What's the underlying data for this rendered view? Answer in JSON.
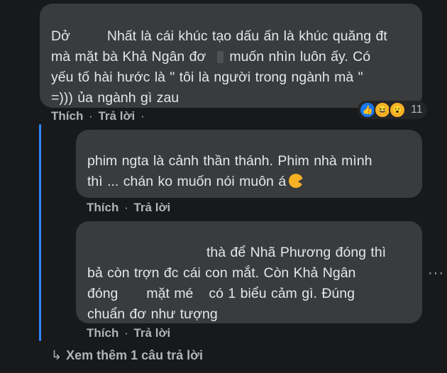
{
  "comments": [
    {
      "lines": [
        [
          "Dở",
          "Nhất là cái khúc tạo dấu ấn là khúc quăng đt"
        ],
        [
          "mà mặt bà Khả Ngân đơ",
          "muốn nhìn luôn ấy. Có"
        ],
        [
          "yếu tố hài hước là \" tôi là người trong ngành mà \""
        ],
        [
          "=))) ủa ngành gì zau"
        ]
      ],
      "like_label": "Thích",
      "reply_label": "Trả lời",
      "dot": "·",
      "reactions": {
        "icons": [
          "like-icon",
          "haha-icon",
          "wow-icon"
        ],
        "count": "11"
      }
    },
    {
      "lines": [
        [
          "phim ngta là cảnh thần thánh. Phim nhà mình"
        ],
        [
          "thì ... chán ko muốn nói muôn á"
        ]
      ],
      "like_label": "Thích",
      "reply_label": "Trả lời",
      "dot": "·"
    },
    {
      "lines": [
        [
          "thà để Nhã Phương đóng thì"
        ],
        [
          "bả còn trợn đc cái con mắt. Còn Khả Ngân"
        ],
        [
          "đóng",
          "mặt mé",
          "có 1 biểu cảm gì. Đúng"
        ],
        [
          "chuẩn đơ như tượng"
        ]
      ],
      "like_label": "Thích",
      "reply_label": "Trả lời",
      "dot": "·"
    }
  ],
  "more_menu": "···",
  "see_more": {
    "arrow": "↳",
    "label": "Xem thêm 1 câu trả lời"
  },
  "colors": {
    "background": "#18191a",
    "bubble": "#3a3b3c",
    "thread_line": "#2d88ff",
    "text": "#e4e6eb",
    "muted": "#b0b3b8"
  }
}
